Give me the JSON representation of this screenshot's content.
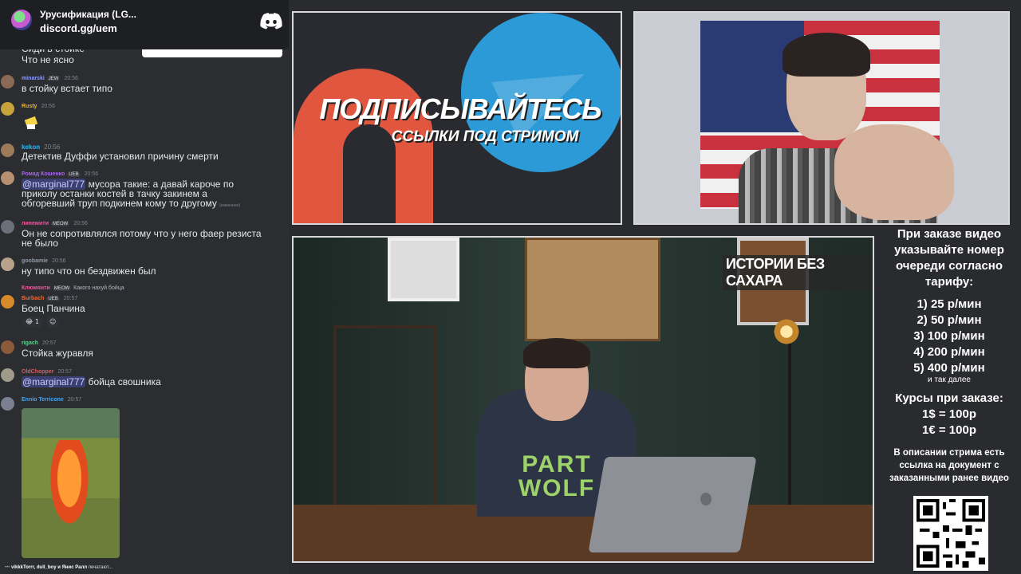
{
  "invite": {
    "server_name": "Урусификация (LG...",
    "link": "discord.gg/uem",
    "icon": "discord-icon"
  },
  "chat": {
    "messages": [
      {
        "user": "",
        "time": "",
        "text": "Сиди в стойке"
      },
      {
        "user": "",
        "time": "",
        "text": "Что не ясно"
      },
      {
        "user": "minarski",
        "tag": "JEW",
        "time": "20:56",
        "text": "в стойку встает типо",
        "name_color": "#8e9dff"
      },
      {
        "user": "Rusty",
        "time": "20:56",
        "text": "",
        "name_color": "#f0b232"
      },
      {
        "user": "kekon",
        "time": "20:56",
        "text": "Детектив Дуффи установил причину смерти",
        "name_color": "#2eb8f0"
      },
      {
        "user": "Ромад Кошенко",
        "tag": "UEB",
        "time": "20:56",
        "mention": "@marginal777",
        "text": "мусора такие: а давай кароче по",
        "text2": "приколу останки костей в тачку закинем а",
        "text3": "обгоревший труп подкинем кому то другому",
        "edited": "(изменено)",
        "name_color": "#a26be0"
      },
      {
        "user": "линемити",
        "tag": "MEOW",
        "time": "20:56",
        "text": "Он не сопротивлялся потому что у него фаер резиста",
        "text2": "не было",
        "name_color": "#e85a9d"
      },
      {
        "user": "goobamie",
        "time": "20:56",
        "text": "ну типо что он бездвижен был",
        "name_color": "#949ba4"
      },
      {
        "reply_to": "Клюмянти",
        "reply_tag": "MEOW",
        "reply_text": "Какого нахуй бойца",
        "user": "Burbach",
        "tag": "UEB",
        "time": "20:57",
        "text": "Боец Панчина",
        "reaction": "1",
        "name_color": "#e86a3a"
      },
      {
        "user": "rigach",
        "time": "20:57",
        "text": "Стойка журавля",
        "name_color": "#5fd18a"
      },
      {
        "user": "OldChopper",
        "time": "20:57",
        "mention": "@marginal777",
        "text": "бойца свошника",
        "name_color": "#e0585a"
      },
      {
        "user": "Ennio Terricone",
        "time": "20:57",
        "text": "",
        "name_color": "#4aa4e8"
      }
    ],
    "typing": {
      "users": "vikkkTorrr, dull_boy и Янис Ралл",
      "suffix": "печатают..."
    }
  },
  "promo": {
    "title": "ПОДПИСЫВАЙТЕСЬ",
    "subtitle": "ССЫЛКИ ПОД СТРИМОМ"
  },
  "video": {
    "badge": "ИСТОРИИ БЕЗ САХАРА",
    "shirt_line1": "PART",
    "shirt_line2": "WOLF"
  },
  "pricing": {
    "intro": "При заказе видео указывайте номер очереди согласно тарифу:",
    "tiers": [
      "1) 25 р/мин",
      "2) 50 р/мин",
      "3) 100 р/мин",
      "4) 200 р/мин",
      "5) 400 р/мин"
    ],
    "more": "и так далее",
    "rates_title": "Курсы при заказе:",
    "rates": [
      "1$ = 100р",
      "1€ = 100р"
    ],
    "note": "В описании стрима есть ссылка на документ с заказанными ранее видео"
  }
}
